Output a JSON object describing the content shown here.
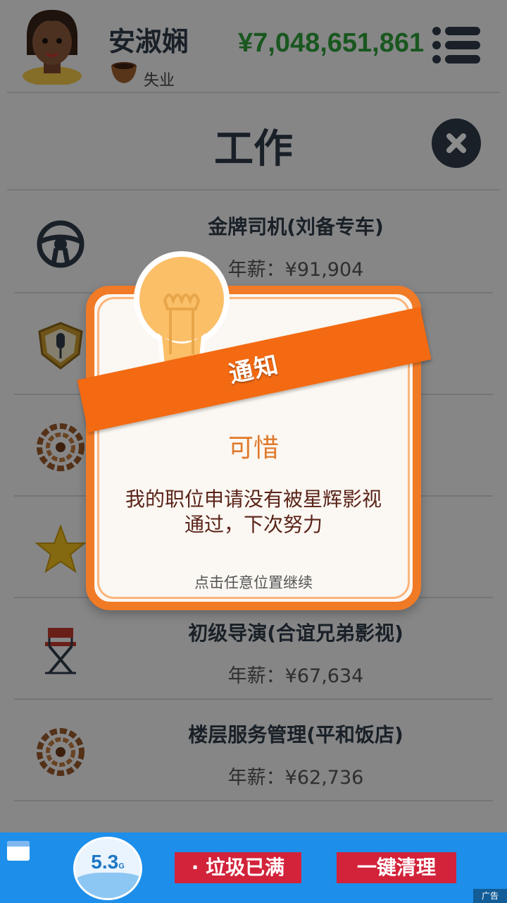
{
  "user": {
    "name": "安淑娴",
    "status": "失业",
    "money": "¥7,048,651,861"
  },
  "page": {
    "title": "工作"
  },
  "jobs": [
    {
      "title": "金牌司机(刘备专车)",
      "salary": "年薪：¥91,904",
      "icon": "steering-wheel-icon"
    },
    {
      "title": "",
      "salary": "",
      "icon": "microphone-badge-icon"
    },
    {
      "title": "",
      "salary": "",
      "icon": "wreath-emblem-icon"
    },
    {
      "title": "",
      "salary": "",
      "icon": "star-icon"
    },
    {
      "title": "初级导演(合谊兄弟影视)",
      "salary": "年薪：¥67,634",
      "icon": "director-chair-icon"
    },
    {
      "title": "楼层服务管理(平和饭店)",
      "salary": "年薪：¥62,736",
      "icon": "wreath-emblem-icon"
    }
  ],
  "dialog": {
    "ribbon": "通知",
    "heading": "可惜",
    "message_line1": "我的职位申请没有被星辉影视",
    "message_line2": "通过，下次努力",
    "hint": "点击任意位置继续"
  },
  "ad": {
    "storage_value": "5.3",
    "storage_unit": "G",
    "full_button": "· 垃圾已满",
    "clean_button": "一键清理",
    "ad_label": "广告"
  },
  "colors": {
    "money": "#2e9e3a",
    "dialog_border": "#f07a26",
    "ribbon": "#f36a12",
    "heading": "#e07a2c",
    "ad_bg": "#1d8fea",
    "ad_button": "#d2233a"
  }
}
